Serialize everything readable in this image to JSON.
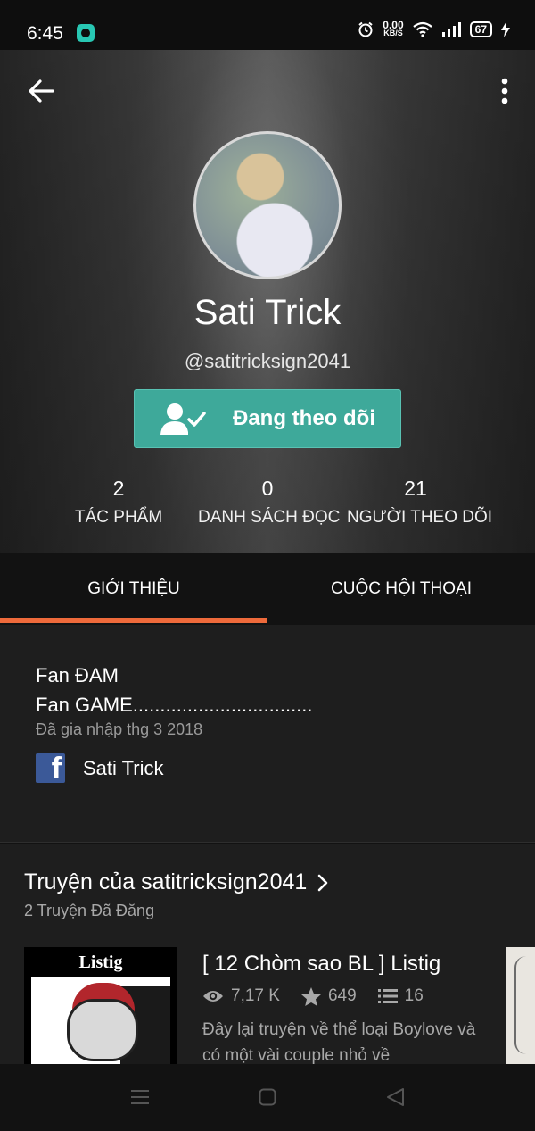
{
  "status_bar": {
    "time": "6:45",
    "net_speed_value": "0.00",
    "net_speed_unit": "KB/S",
    "battery": "67",
    "icons": [
      "app-notification-icon",
      "alarm-icon",
      "wifi-icon",
      "signal-icon",
      "battery-icon",
      "charging-icon"
    ]
  },
  "header": {
    "back_icon": "back-arrow-icon",
    "more_icon": "more-vertical-icon"
  },
  "profile": {
    "name": "Sati Trick",
    "handle": "@satitricksign2041",
    "follow_button_label": "Đang theo dõi",
    "follow_icon": "user-check-icon",
    "accent_color": "#3ea99a"
  },
  "stats": [
    {
      "value": "2",
      "label": "TÁC PHẨM"
    },
    {
      "value": "0",
      "label": "DANH SÁCH ĐỌC"
    },
    {
      "value": "21",
      "label": "NGƯỜI THEO DÕI"
    }
  ],
  "tabs": [
    {
      "label": "GIỚI THIỆU",
      "active": true
    },
    {
      "label": "CUỘC HỘI THOẠI",
      "active": false
    }
  ],
  "tab_indicator_color": "#ee6a3b",
  "about": {
    "line1": "Fan ĐAM",
    "line2": "Fan GAME.................................",
    "joined": "Đã gia nhập thg 3 2018",
    "facebook_icon": "facebook-icon",
    "facebook_name": "Sati Trick"
  },
  "stories": {
    "title": "Truyện của satitricksign2041",
    "count": "2 Truyện Đã Đăng",
    "items": [
      {
        "cover_text": "Listig",
        "title": "[ 12 Chòm sao BL ] Listig",
        "views": "7,17 K",
        "votes": "649",
        "parts": "16",
        "description": "Đây lại truyện về thể loại Boylove và có một vài couple nhỏ về"
      }
    ]
  },
  "navbar": {
    "icons": [
      "menu-icon",
      "home-square-icon",
      "back-triangle-icon"
    ]
  }
}
